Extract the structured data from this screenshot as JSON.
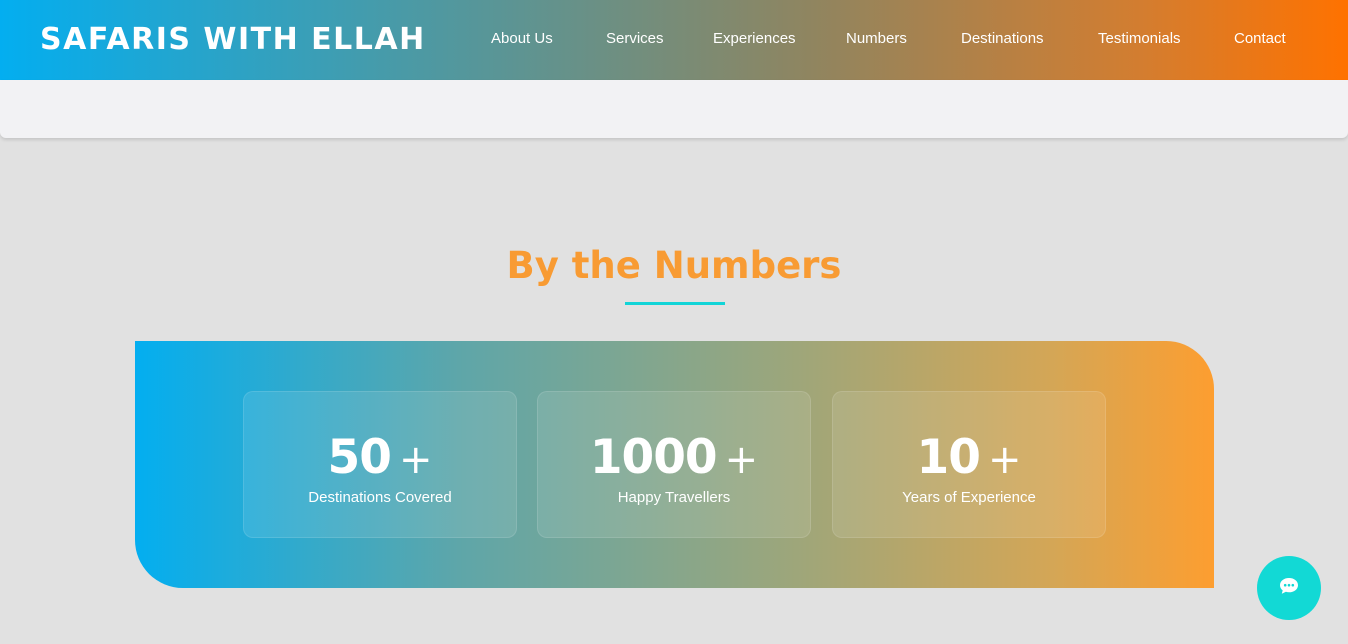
{
  "header": {
    "brand": "SAFARIS WITH ELLAH",
    "nav": {
      "about": "About Us",
      "services": "Services",
      "experiences": "Experiences",
      "numbers": "Numbers",
      "destinations": "Destinations",
      "testimonials": "Testimonials",
      "contact": "Contact"
    }
  },
  "numbers_section": {
    "title": "By the Numbers",
    "stats": [
      {
        "value": "50",
        "suffix": "+",
        "label": "Destinations Covered"
      },
      {
        "value": "1000",
        "suffix": "+",
        "label": "Happy Travellers"
      },
      {
        "value": "10",
        "suffix": "+",
        "label": "Years of Experience"
      }
    ]
  },
  "chat": {
    "icon": "chat-bubble-icon"
  },
  "colors": {
    "accent_orange": "#f89b33",
    "accent_teal": "#12d4d7",
    "gradient_start": "#03aef0",
    "gradient_end": "#ff7200",
    "page_background": "#e1e1e1"
  }
}
